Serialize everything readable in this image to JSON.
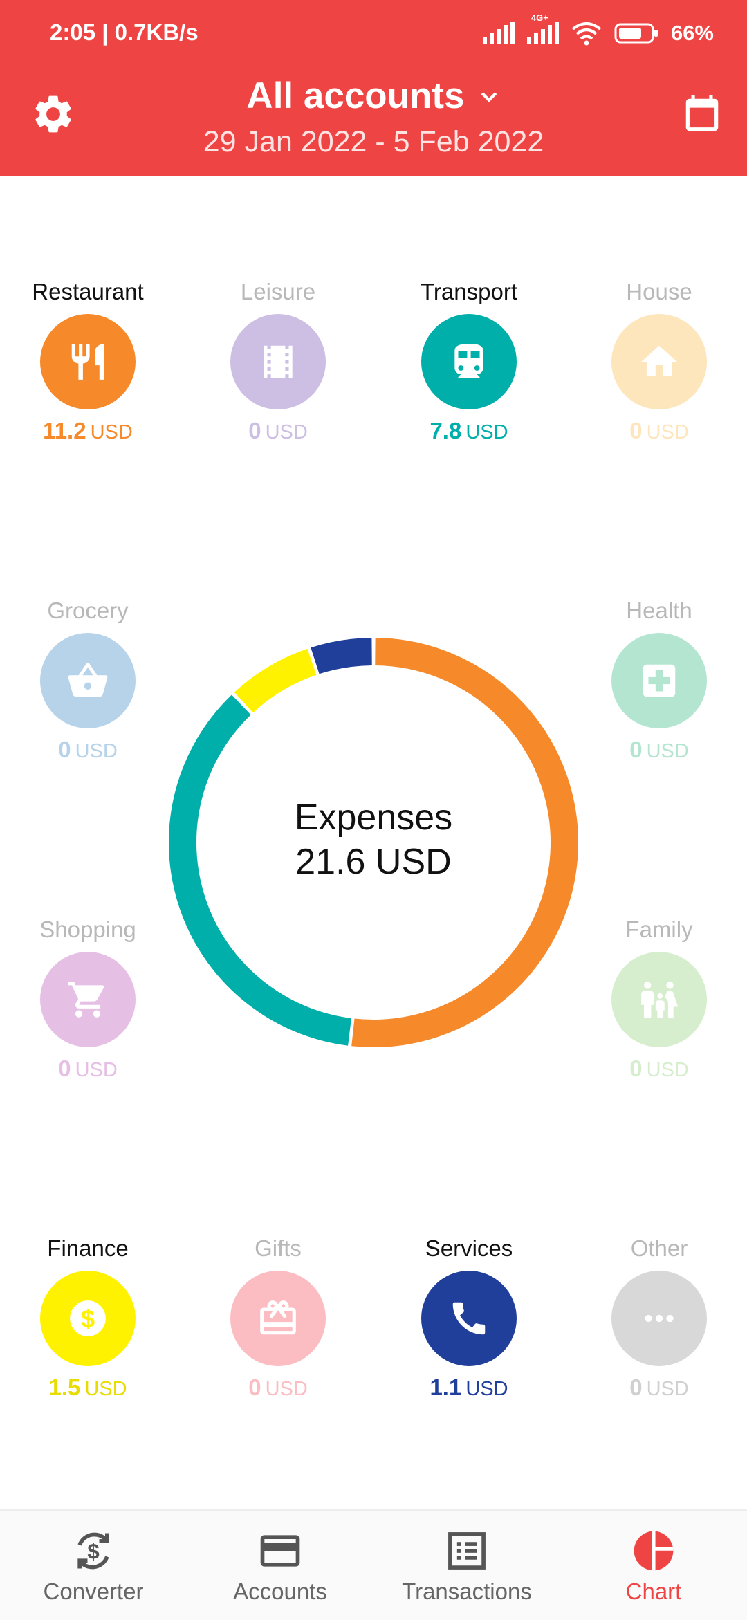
{
  "status": {
    "time_speed": "2:05 | 0.7KB/s",
    "net_type": "4G+",
    "battery": "66%"
  },
  "header": {
    "title": "All accounts",
    "date_range": "29 Jan 2022 - 5 Feb 2022",
    "accent_color": "#ef4444"
  },
  "categories": {
    "restaurant": {
      "name": "Restaurant",
      "amount": "11.2",
      "currency": "USD",
      "color": "#f68a2a",
      "icon": "cutlery-icon"
    },
    "leisure": {
      "name": "Leisure",
      "amount": "0",
      "currency": "USD",
      "color": "#cdbfe4",
      "icon": "film-icon"
    },
    "transport": {
      "name": "Transport",
      "amount": "7.8",
      "currency": "USD",
      "color": "#00aeaa",
      "icon": "train-icon"
    },
    "house": {
      "name": "House",
      "amount": "0",
      "currency": "USD",
      "color": "#fde5bc",
      "icon": "house-icon"
    },
    "grocery": {
      "name": "Grocery",
      "amount": "0",
      "currency": "USD",
      "color": "#b6d3ea",
      "icon": "basket-icon"
    },
    "health": {
      "name": "Health",
      "amount": "0",
      "currency": "USD",
      "color": "#b3e5d1",
      "icon": "medical-icon"
    },
    "shopping": {
      "name": "Shopping",
      "amount": "0",
      "currency": "USD",
      "color": "#e5bfe4",
      "icon": "cart-icon"
    },
    "family": {
      "name": "Family",
      "amount": "0",
      "currency": "USD",
      "color": "#d6eece",
      "icon": "family-icon"
    },
    "finance": {
      "name": "Finance",
      "amount": "1.5",
      "currency": "USD",
      "color": "#fff200",
      "icon": "dollar-icon"
    },
    "gifts": {
      "name": "Gifts",
      "amount": "0",
      "currency": "USD",
      "color": "#fbbdc2",
      "icon": "gift-icon"
    },
    "services": {
      "name": "Services",
      "amount": "1.1",
      "currency": "USD",
      "color": "#203f9b",
      "icon": "phone-icon"
    },
    "other": {
      "name": "Other",
      "amount": "0",
      "currency": "USD",
      "color": "#d8d8d8",
      "icon": "more-icon"
    }
  },
  "center": {
    "label": "Expenses",
    "total": "21.6 USD"
  },
  "chart_data": {
    "type": "pie",
    "categories": [
      "Restaurant",
      "Transport",
      "Finance",
      "Services"
    ],
    "values": [
      11.2,
      7.8,
      1.5,
      1.1
    ],
    "colors": [
      "#f68a2a",
      "#00aeaa",
      "#fff200",
      "#203f9b"
    ]
  },
  "nav": {
    "converter": "Converter",
    "accounts": "Accounts",
    "transactions": "Transactions",
    "chart": "Chart"
  }
}
